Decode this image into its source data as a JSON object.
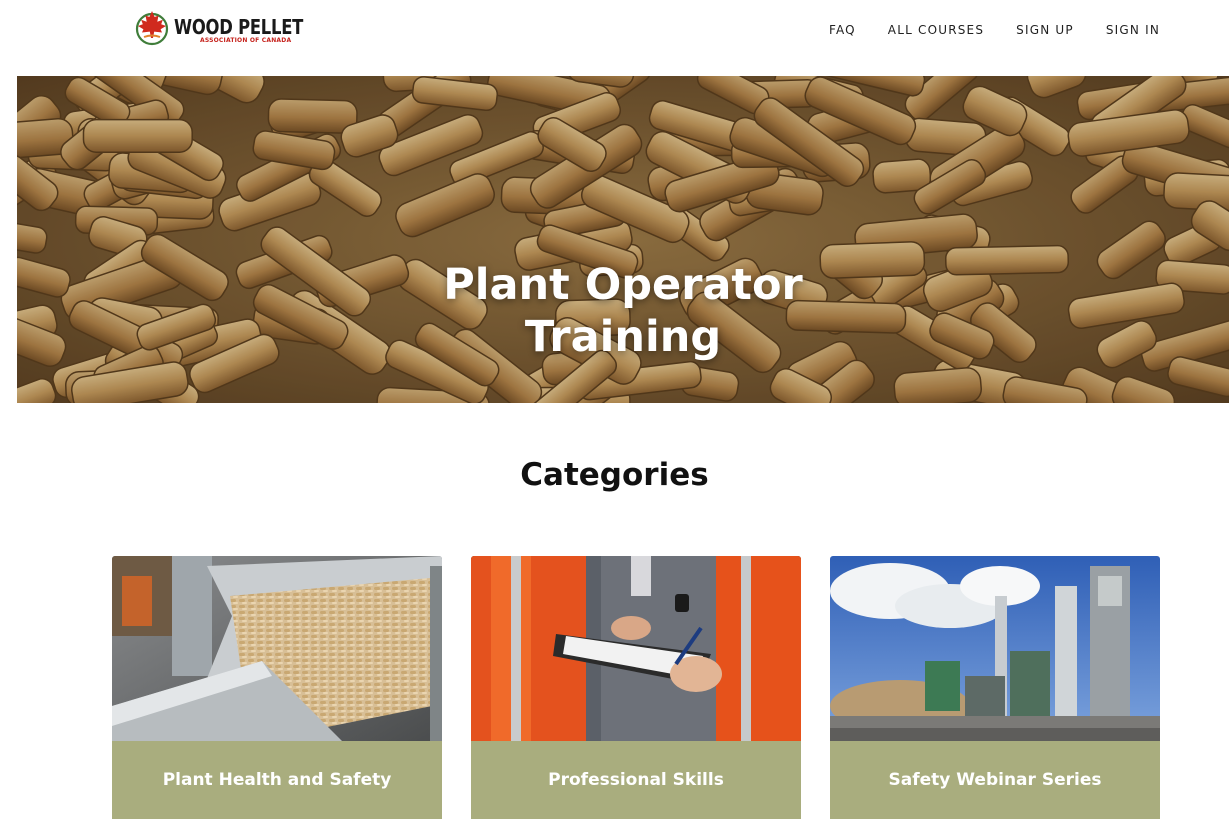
{
  "header": {
    "logo": {
      "title": "WOOD PELLET",
      "subtitle": "ASSOCIATION OF CANADA",
      "icon": "maple-leaf-icon"
    },
    "nav": [
      "FAQ",
      "ALL COURSES",
      "SIGN UP",
      "SIGN IN"
    ]
  },
  "hero": {
    "title_line1": "Plant Operator",
    "title_line2": "Training",
    "image": "wood-pellets-photo"
  },
  "categories": {
    "title": "Categories",
    "items": [
      {
        "label": "Plant Health and Safety",
        "image": "pellet-conveyor-photo"
      },
      {
        "label": "Professional Skills",
        "image": "workers-with-clipboard-photo"
      },
      {
        "label": "Safety Webinar Series",
        "image": "pellet-plant-exterior-photo"
      }
    ]
  },
  "colors": {
    "card_band": "#a9ad7e",
    "logo_red": "#c6231d",
    "text": "#111111"
  }
}
